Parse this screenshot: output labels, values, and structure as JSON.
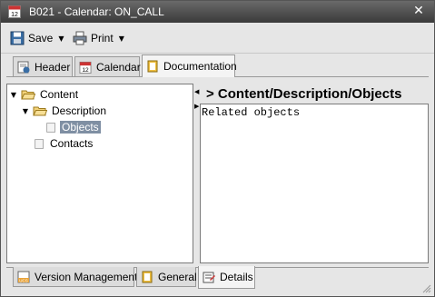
{
  "window": {
    "title": "B021 - Calendar: ON_CALL",
    "app_icon": "calendar-12-icon",
    "close_glyph": "✕"
  },
  "toolbar": {
    "save_label": "Save",
    "print_label": "Print",
    "dropdown_glyph": "▼"
  },
  "tabs": [
    {
      "label": "Header",
      "icon": "header-icon"
    },
    {
      "label": "Calendar",
      "icon": "calendar-12-icon"
    },
    {
      "label": "Documentation",
      "icon": "documentation-icon",
      "active": true
    }
  ],
  "tree": {
    "expanded_glyph": "▼",
    "nodes": [
      {
        "label": "Content",
        "icon": "folder-open-icon"
      },
      {
        "label": "Description",
        "icon": "folder-open-icon"
      },
      {
        "label": "Objects",
        "icon": "page-icon",
        "selected": true
      },
      {
        "label": "Contacts",
        "icon": "page-icon"
      }
    ]
  },
  "document": {
    "heading": "> Content/Description/Objects",
    "text": "Related objects"
  },
  "bottom_tabs": [
    {
      "label": "Version Management",
      "icon": "ucs-icon"
    },
    {
      "label": "General",
      "icon": "documentation-icon"
    },
    {
      "label": "Details",
      "icon": "details-icon",
      "active": true
    }
  ],
  "colors": {
    "titlebar": "#4a4a4a",
    "selection": "#7f8fa3",
    "folder": "#e8c040"
  }
}
